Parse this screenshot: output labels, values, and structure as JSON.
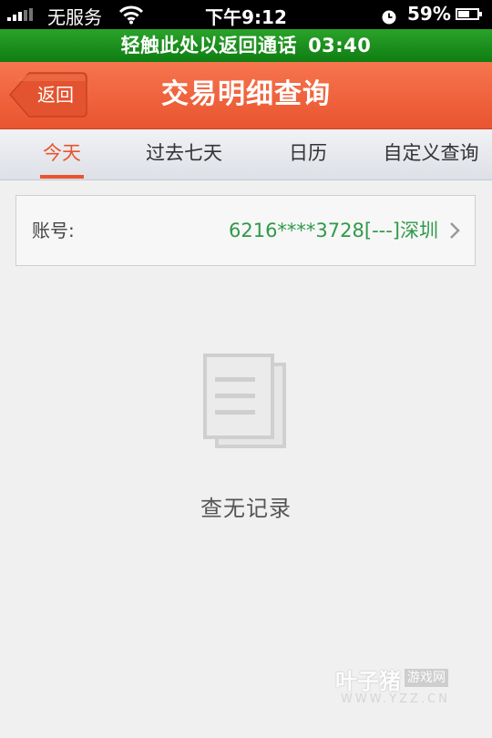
{
  "status_bar": {
    "carrier": "无服务",
    "time": "下午9:12",
    "battery_percent": "59%",
    "battery_level": 0.59,
    "colors": {
      "background": "#000000",
      "text": "#ffffff"
    }
  },
  "call_bar": {
    "text": "轻触此处以返回通话",
    "call_time": "03:40",
    "color": "#1a911c"
  },
  "nav": {
    "back_label": "返回",
    "title": "交易明细查询",
    "color": "#ee6340"
  },
  "tabs": [
    {
      "label": "今天",
      "active": true
    },
    {
      "label": "过去七天",
      "active": false
    },
    {
      "label": "日历",
      "active": false
    },
    {
      "label": "自定义查询",
      "active": false
    }
  ],
  "account": {
    "label": "账号:",
    "value": "6216****3728[---]深圳",
    "value_color": "#2f9a4a"
  },
  "empty_state": {
    "icon": "document-icon",
    "text": "查无记录"
  },
  "watermark": {
    "brand": "叶子猪",
    "tag": "游戏网",
    "url": "WWW.YZZ.CN"
  },
  "colors": {
    "accent": "#e9542f",
    "background": "#f0f0f0"
  }
}
